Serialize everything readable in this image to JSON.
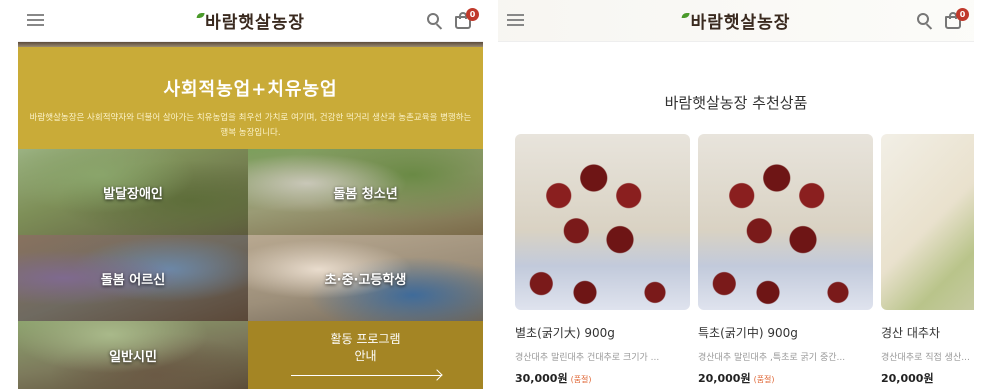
{
  "left": {
    "header": {
      "logo": "바람햇살농장",
      "cart_count": "0"
    },
    "hero": {
      "title": "사회적농업+치유농업",
      "description": "바람햇살농장은 사회적약자와 더불어 살아가는 치유농업을 최우선 가치로 여기며, 건강한 먹거리 생산과 농촌교육을 병행하는 행복 농장입니다."
    },
    "tiles": [
      {
        "label": "발달장애인"
      },
      {
        "label": "돌봄 청소년"
      },
      {
        "label": "돌봄 어르신"
      },
      {
        "label": "초·중·고등학생"
      },
      {
        "label": "일반시민"
      }
    ],
    "program": {
      "line1": "활동 프로그램",
      "line2": "안내"
    }
  },
  "right": {
    "header": {
      "logo": "바람햇살농장",
      "cart_count": "0"
    },
    "section_title": "바람햇살농장 추천상품",
    "products": [
      {
        "name": "별초(굵기大) 900g",
        "desc": "경산대추 말린대추 건대추로 크기가 ...",
        "price": "30,000원",
        "badge": "(품절)"
      },
      {
        "name": "특초(굵기中) 900g",
        "desc": "경산대추 말린대추 ,특초로 굵기 중간...",
        "price": "20,000원",
        "badge": "(품절)"
      },
      {
        "name": "경산 대추차",
        "desc": "경산대추로 직접 생산...",
        "price": "20,000원",
        "badge": ""
      }
    ]
  },
  "icons": [
    "hamburger-icon",
    "search-icon",
    "shopping-bag-icon",
    "arrow-right-icon"
  ],
  "colors": {
    "hero_bg": "#c9ab38",
    "program_bg": "#a48524",
    "badge_red": "#c0392b",
    "soldout": "#e06a3a"
  }
}
